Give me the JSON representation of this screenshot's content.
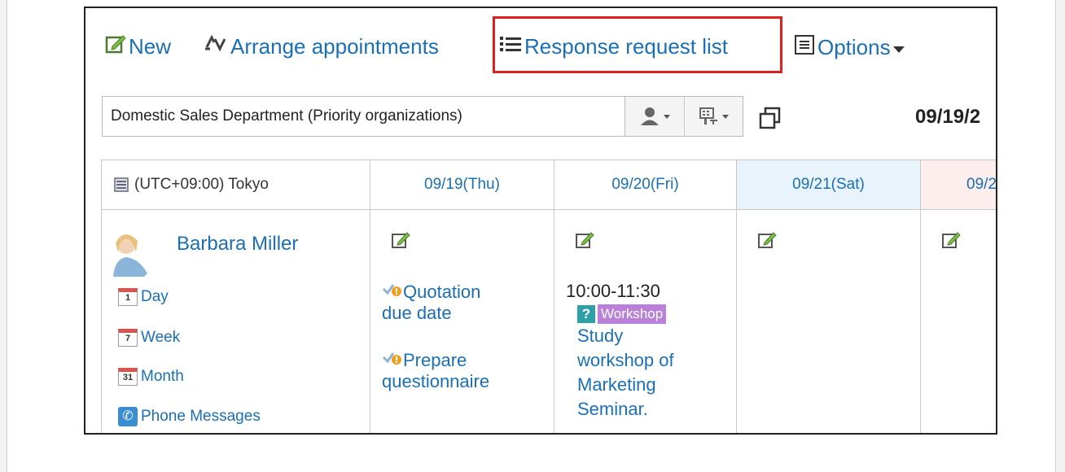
{
  "toolbar": {
    "new_label": "New",
    "arrange_label": "Arrange appointments",
    "response_label": "Response request list",
    "options_label": "Options"
  },
  "org": {
    "selected": "Domestic Sales Department (Priority organizations)"
  },
  "date_heading": "09/19/2",
  "grid": {
    "timezone": "(UTC+09:00) Tokyo",
    "columns": [
      {
        "label": "09/19(Thu)"
      },
      {
        "label": "09/20(Fri)"
      },
      {
        "label": "09/21(Sat)"
      },
      {
        "label": "09/2"
      }
    ]
  },
  "user": {
    "name": "Barbara Miller",
    "links": {
      "day": "Day",
      "week": "Week",
      "month": "Month",
      "phone": "Phone Messages"
    },
    "cal_numbers": {
      "day": "1",
      "week": "7",
      "month": "31"
    }
  },
  "events": {
    "thu": [
      {
        "line1": "Quotation",
        "line2": "due date"
      },
      {
        "line1": "Prepare",
        "line2": "questionnaire"
      }
    ],
    "fri": {
      "time": "10:00-11:30",
      "status_icon": "?",
      "category": "Workshop",
      "title_lines": [
        "Study",
        "workshop of",
        "Marketing",
        "Seminar."
      ]
    }
  },
  "colors": {
    "link": "#1a6fb5",
    "highlight": "#e02020",
    "saturday_bg": "#e8f3fb",
    "sunday_bg": "#fdeeee",
    "workshop": "#b982d8",
    "status_teal": "#2ea1a8"
  },
  "icons": [
    "new-schedule-icon",
    "arrange-icon",
    "list-icon",
    "options-icon",
    "user-filter-icon",
    "facility-filter-icon",
    "popout-icon",
    "timezone-icon",
    "calendar-icon",
    "phone-icon",
    "todo-check-icon",
    "edit-icon"
  ]
}
